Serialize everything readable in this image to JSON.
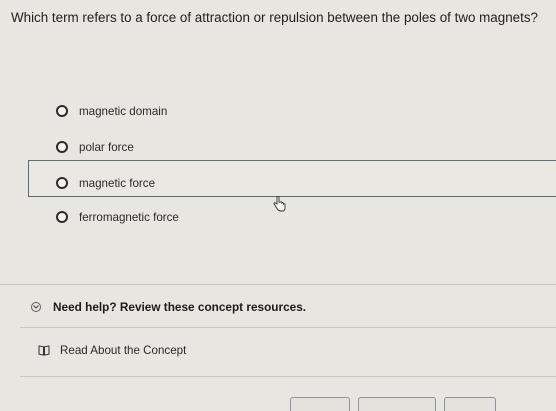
{
  "question": {
    "text": "Which term refers to a force of attraction or repulsion between the poles of two magnets?"
  },
  "options": [
    {
      "label": "magnetic domain",
      "selected": false
    },
    {
      "label": "polar force",
      "selected": false
    },
    {
      "label": "magnetic force",
      "selected": false,
      "hovered": true
    },
    {
      "label": "ferromagnetic force",
      "selected": false
    }
  ],
  "help": {
    "title": "Need help? Review these concept resources.",
    "icon": "chevron-down-circle-icon"
  },
  "resources": [
    {
      "label": "Read About the Concept",
      "icon": "book-icon"
    }
  ],
  "colors": {
    "background": "#e7e6e1",
    "highlight_border": "#5a6e74",
    "text": "#1f1f1f"
  }
}
